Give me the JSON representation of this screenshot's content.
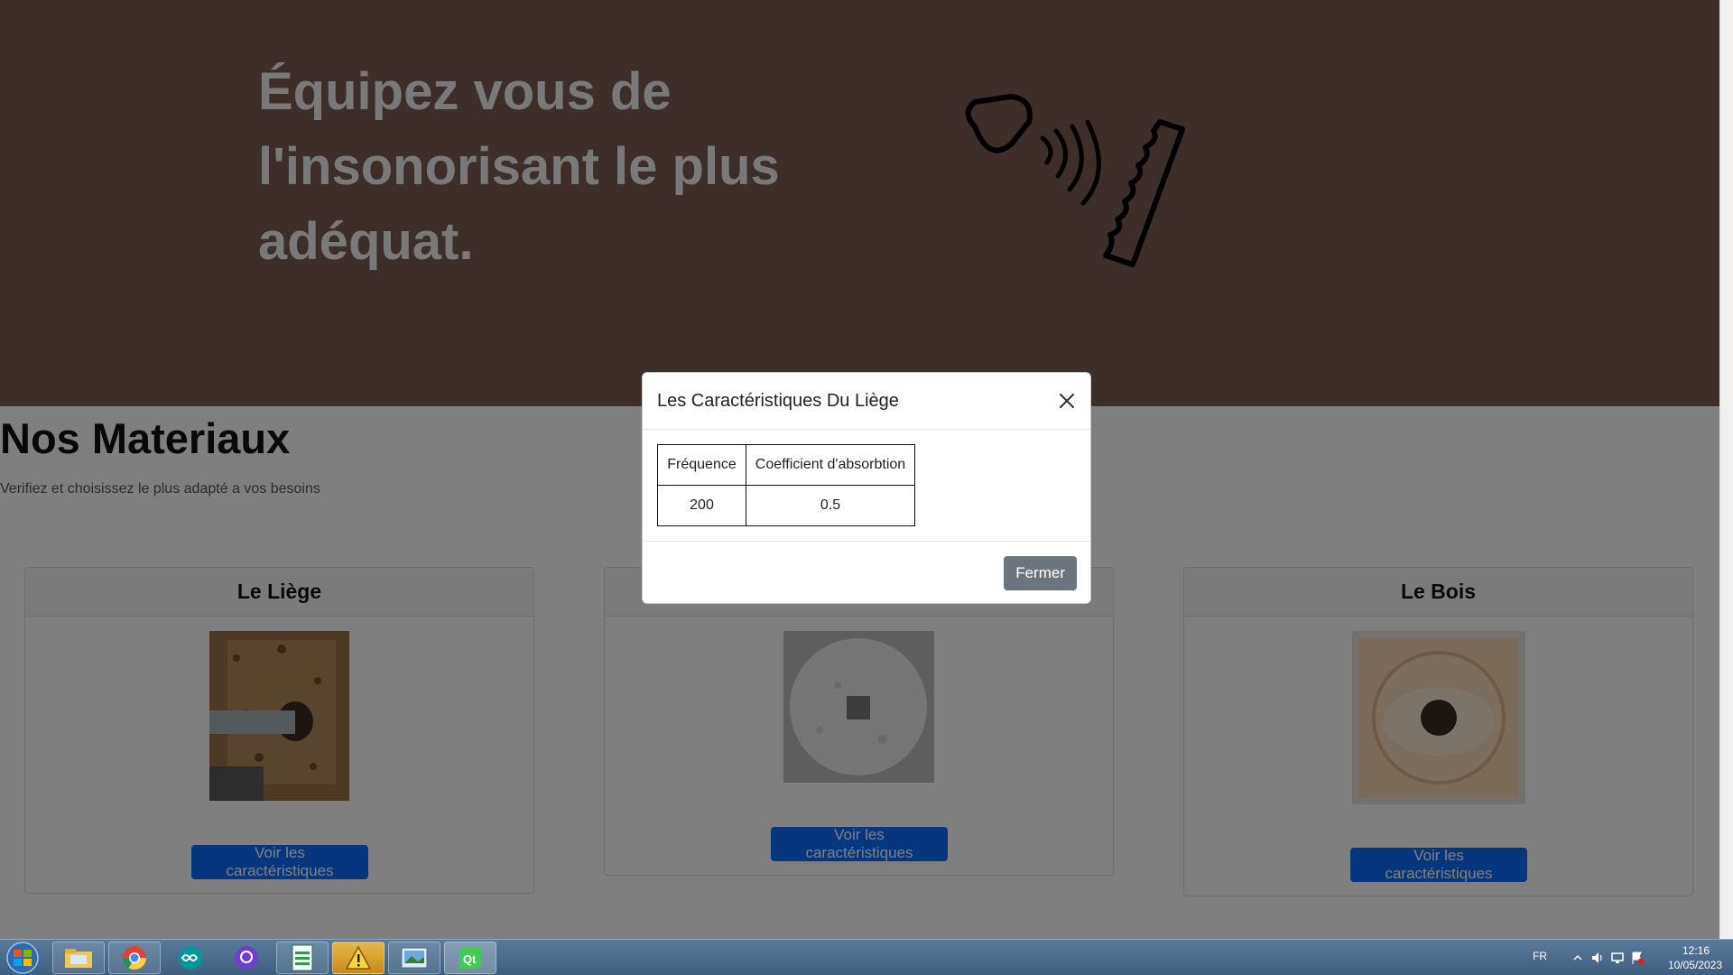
{
  "hero": {
    "line1": "Équipez vous de",
    "line2": "l'insonorisant le plus",
    "line3": "adéquat."
  },
  "section": {
    "title": "Nos Materiaux",
    "subtitle": "Verifiez et choisissez le plus adapté a vos besoins"
  },
  "cards": [
    {
      "title": "Le Liège",
      "button": "Voir les caractéristiques"
    },
    {
      "title": "",
      "button": "Voir les caractéristiques"
    },
    {
      "title": "Le Bois",
      "button": "Voir les caractéristiques"
    }
  ],
  "modal": {
    "title": "Les Caractéristiques Du Liège",
    "table": {
      "headers": [
        "Fréquence",
        "Coefficient d'absorbtion"
      ],
      "rows": [
        [
          "200",
          "0.5"
        ]
      ]
    },
    "close_button": "Fermer"
  },
  "taskbar": {
    "apps": [
      "file-explorer-icon",
      "chrome-icon",
      "arduino-icon",
      "github-icon",
      "spreadsheet-icon",
      "warning-icon",
      "photo-viewer-icon",
      "qt-creator-icon"
    ],
    "language": "FR",
    "time": "12:16",
    "date": "10/05/2023"
  },
  "colors": {
    "hero_bg": "#7a5c55",
    "primary_button": "#0d6efd",
    "secondary_button": "#6c757d",
    "backdrop": "rgba(0,0,0,0.5)"
  }
}
